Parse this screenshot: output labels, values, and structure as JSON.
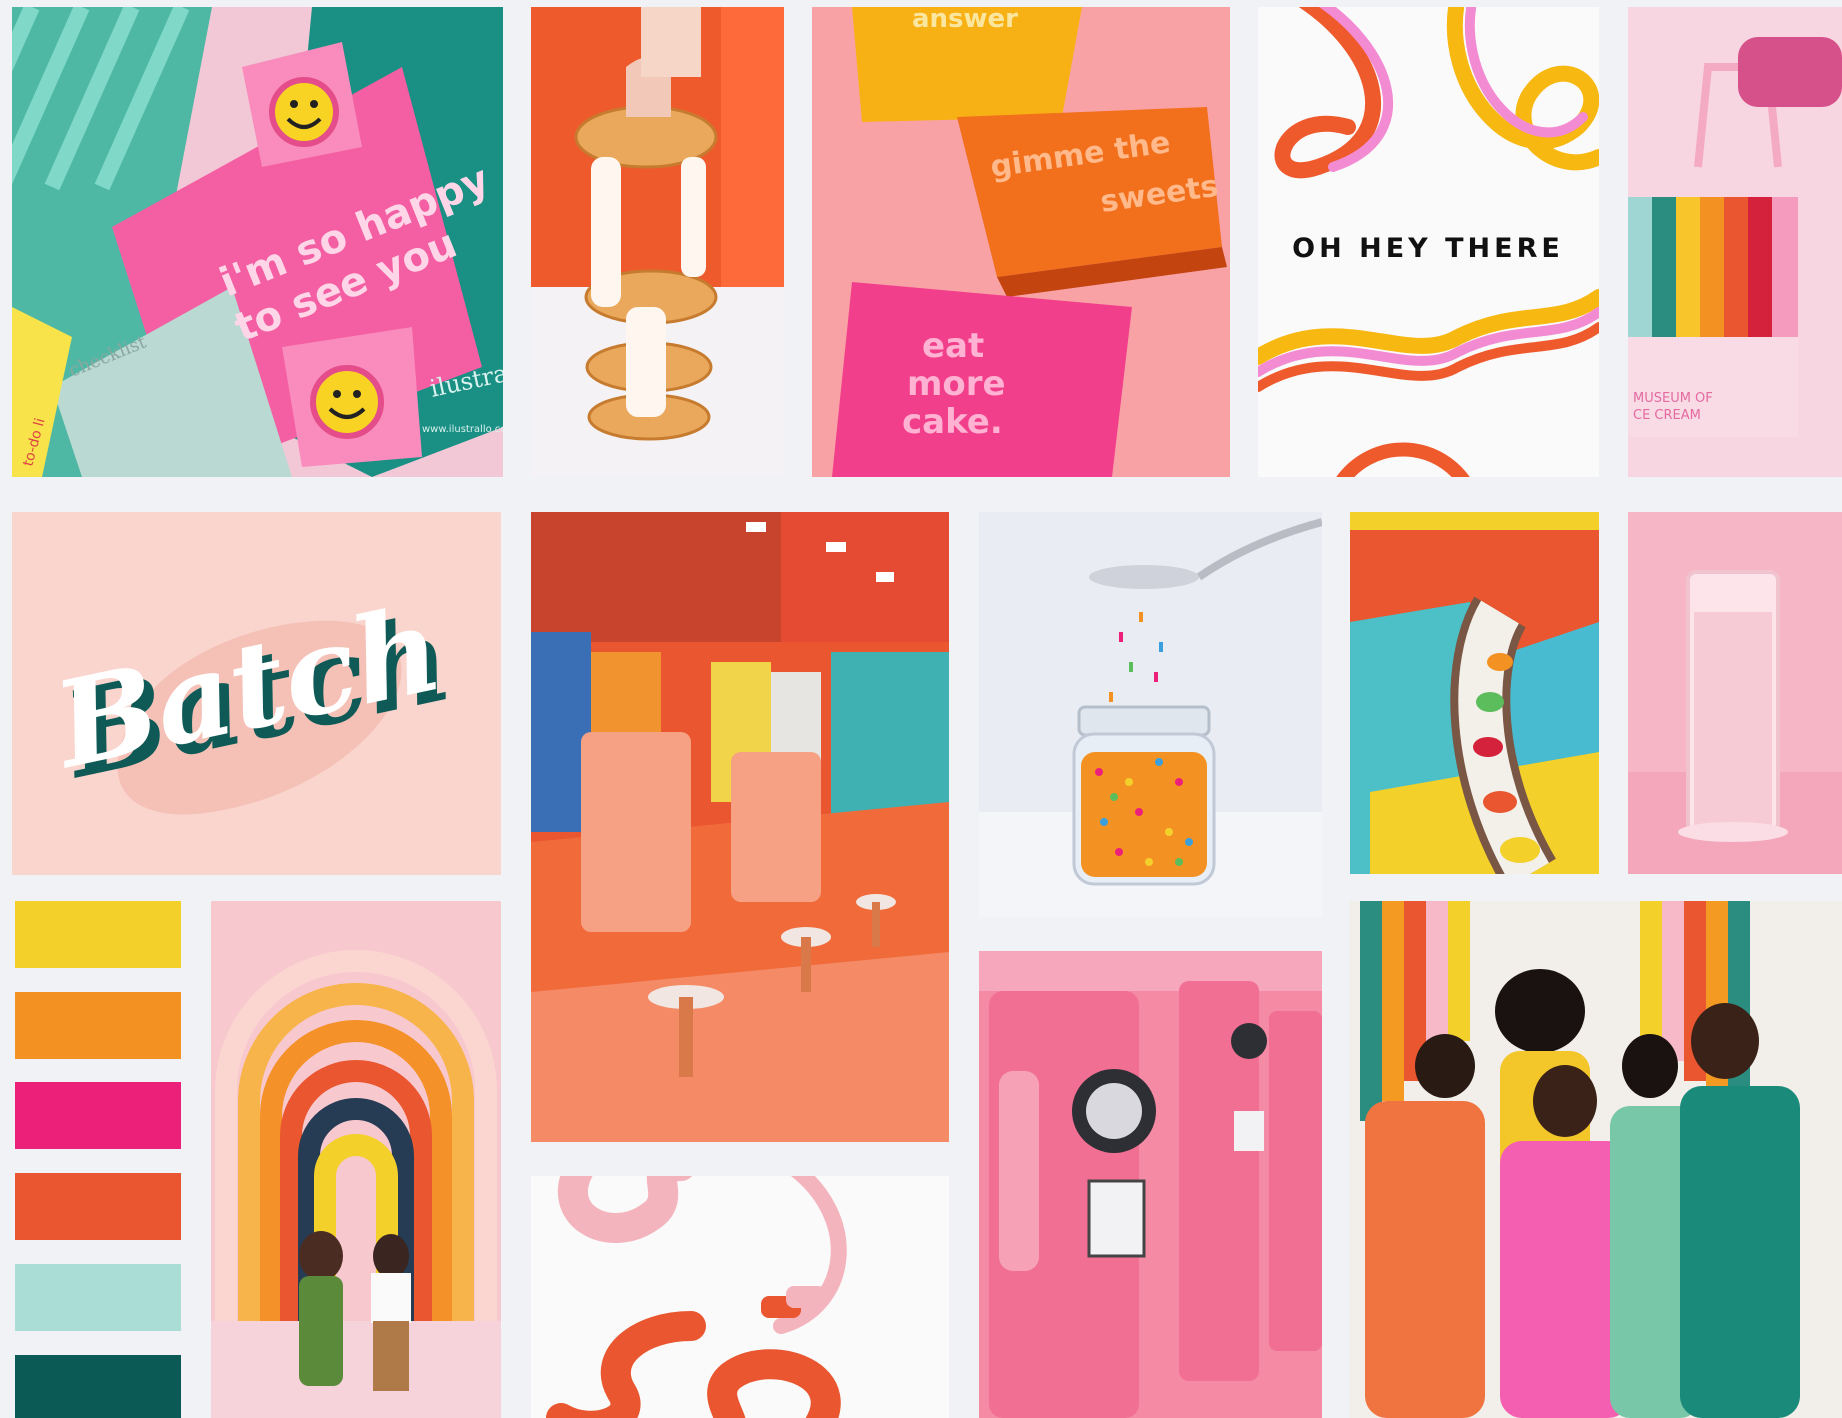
{
  "tiles": {
    "stationery": {
      "note_text_1": "i'm so happy",
      "note_text_2": "to see you",
      "brand": "ilustrall",
      "url": "www.ilustrallo.com",
      "pad": "checklist",
      "todo": "to-do li"
    },
    "boxes": {
      "box1": "answer",
      "box2_line1": "gimme the",
      "box2_line2": "sweets",
      "box3_line1": "eat",
      "box3_line2": "more",
      "box3_line3": "cake."
    },
    "ohhey": {
      "text": "OH HEY THERE"
    },
    "bag": {
      "line1": "MUSEUM OF",
      "line2": "CE CREAM"
    },
    "batch": {
      "logo_text": "Batch"
    }
  },
  "palette": [
    {
      "name": "yellow",
      "color": "#f3d02a"
    },
    {
      "name": "orange",
      "color": "#f39222"
    },
    {
      "name": "magenta",
      "color": "#ec1f79"
    },
    {
      "name": "red-orange",
      "color": "#e9562f"
    },
    {
      "name": "mint",
      "color": "#a9ddd6"
    },
    {
      "name": "dark-teal",
      "color": "#0c5a55"
    }
  ]
}
